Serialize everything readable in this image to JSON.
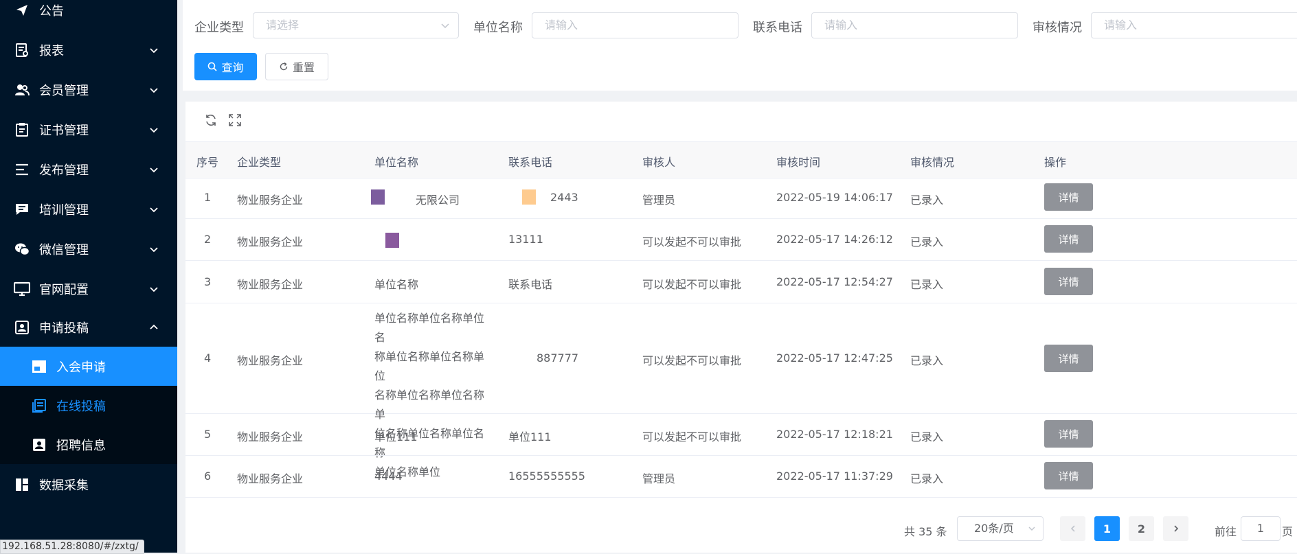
{
  "sidebar": {
    "items": [
      {
        "label": "公告",
        "icon": "send-icon"
      },
      {
        "label": "报表",
        "icon": "report-icon"
      },
      {
        "label": "会员管理",
        "icon": "users-icon"
      },
      {
        "label": "证书管理",
        "icon": "clipboard-icon"
      },
      {
        "label": "发布管理",
        "icon": "list-icon"
      },
      {
        "label": "培训管理",
        "icon": "message-icon"
      },
      {
        "label": "微信管理",
        "icon": "wechat-icon"
      },
      {
        "label": "官网配置",
        "icon": "monitor-icon"
      },
      {
        "label": "申请投稿",
        "icon": "id-card-icon"
      },
      {
        "label": "数据采集",
        "icon": "dashboard-icon"
      }
    ],
    "sub_items": [
      {
        "label": "入会申请",
        "icon": "window-icon"
      },
      {
        "label": "在线投稿",
        "icon": "document-icon"
      },
      {
        "label": "招聘信息",
        "icon": "profile-icon"
      }
    ]
  },
  "status_url": "192.168.51.28:8080/#/zxtg/",
  "search": {
    "company_type_label": "企业类型",
    "company_type_placeholder": "请选择",
    "unit_name_label": "单位名称",
    "unit_name_placeholder": "请输入",
    "phone_label": "联系电话",
    "phone_placeholder": "请输入",
    "review_label": "审核情况",
    "review_placeholder": "请输入",
    "query_button": "查询",
    "reset_button": "重置"
  },
  "table": {
    "headers": [
      "序号",
      "企业类型",
      "单位名称",
      "联系电话",
      "审核人",
      "审核时间",
      "审核情况",
      "操作"
    ],
    "rows": [
      {
        "index": "1",
        "type": "物业服务企业",
        "name": "无限公司",
        "phone": "2443",
        "reviewer": "管理员",
        "time": "2022-05-19 14:06:17",
        "status": "已录入",
        "action": "详情"
      },
      {
        "index": "2",
        "type": "物业服务企业",
        "name": "",
        "phone": "13111",
        "reviewer": "可以发起不可以审批",
        "time": "2022-05-17 14:26:12",
        "status": "已录入",
        "action": "详情"
      },
      {
        "index": "3",
        "type": "物业服务企业",
        "name": "单位名称",
        "phone": "联系电话",
        "reviewer": "可以发起不可以审批",
        "time": "2022-05-17 12:54:27",
        "status": "已录入",
        "action": "详情"
      },
      {
        "index": "4",
        "type": "物业服务企业",
        "name": "单位名称单位名称单位名称单位名称单位名称单位名称单位名称单位名称单位名称单位名称单位名称单位名称单位",
        "phone": "887777",
        "reviewer": "可以发起不可以审批",
        "time": "2022-05-17 12:47:25",
        "status": "已录入",
        "action": "详情"
      },
      {
        "index": "5",
        "type": "物业服务企业",
        "name": "单位111",
        "phone": "单位111",
        "reviewer": "可以发起不可以审批",
        "time": "2022-05-17 12:18:21",
        "status": "已录入",
        "action": "详情"
      },
      {
        "index": "6",
        "type": "物业服务企业",
        "name": "4444",
        "phone": "16555555555",
        "reviewer": "管理员",
        "time": "2022-05-17 11:37:29",
        "status": "已录入",
        "action": "详情"
      }
    ],
    "row4_name_lines": [
      "单位名称单位名称单位名",
      "称单位名称单位名称单位",
      "名称单位名称单位名称单",
      "位名称单位名称单位名称",
      "单位名称单位"
    ]
  },
  "pagination": {
    "total": "共 35 条",
    "page_size": "20条/页",
    "pages": [
      "1",
      "2"
    ],
    "current_page": "1",
    "goto_label": "前往",
    "goto_value": "1",
    "page_suffix": "页"
  },
  "colors": {
    "sidebar_bg": "#001529",
    "primary": "#1890ff",
    "detail_btn": "#909399",
    "redact_purple": "#7c5d9e",
    "redact_orange": "#fecb8f"
  }
}
